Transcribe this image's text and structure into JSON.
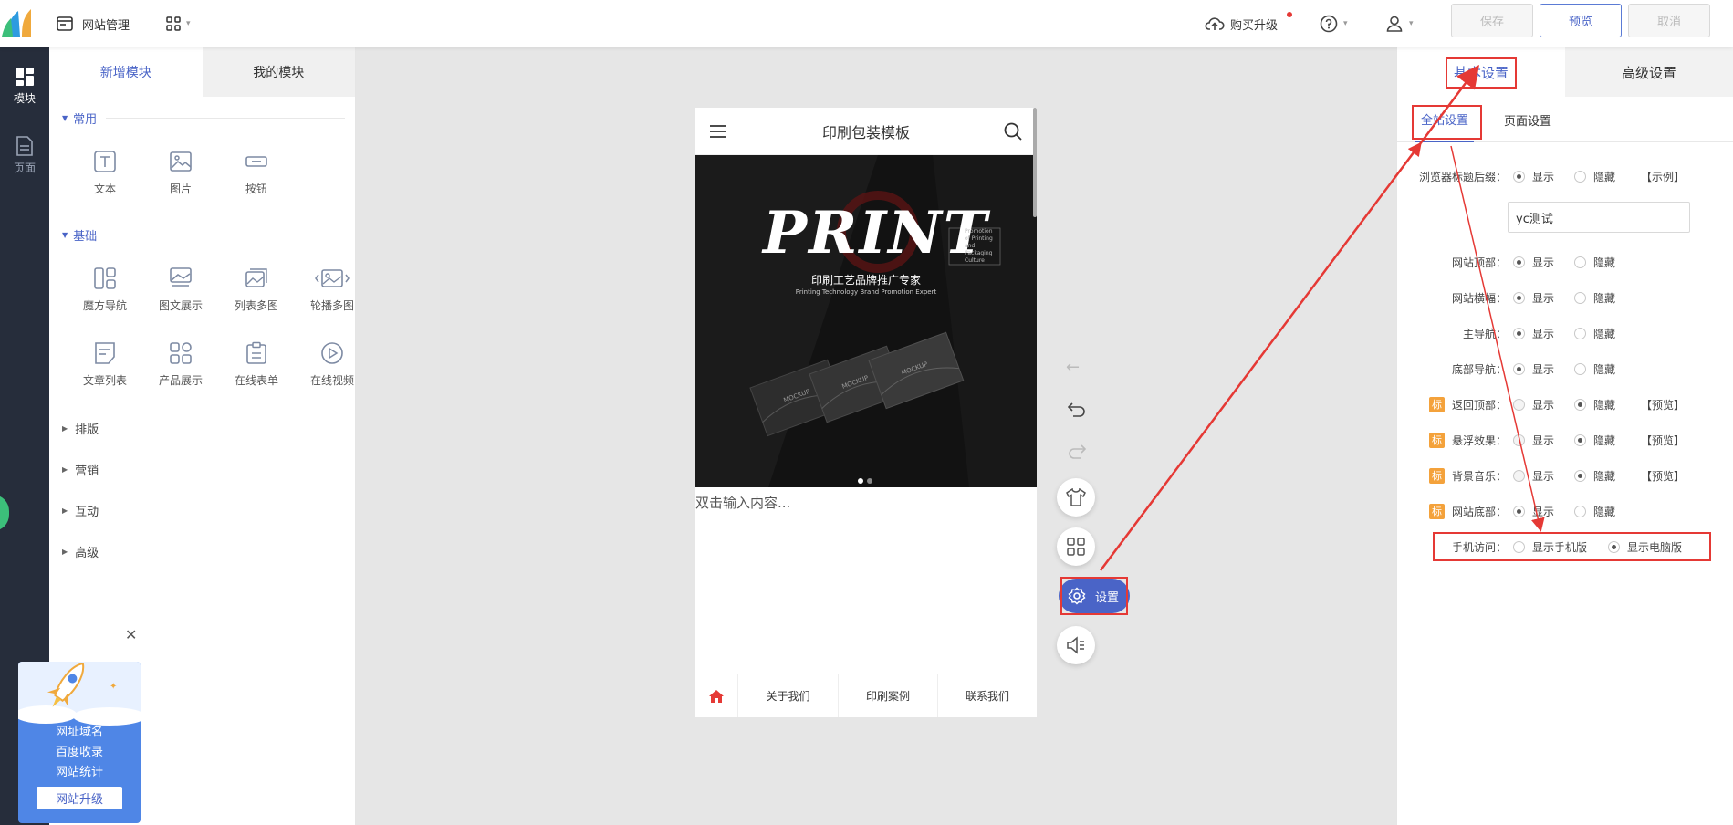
{
  "topbar": {
    "site_manage": "网站管理",
    "upgrade": "购买升级",
    "save": "保存",
    "preview": "预览",
    "cancel": "取消"
  },
  "leftnav": {
    "items": [
      {
        "label": "模块",
        "icon": "modules-icon"
      },
      {
        "label": "页面",
        "icon": "page-icon"
      }
    ]
  },
  "panel": {
    "tabs": [
      "新增模块",
      "我的模块"
    ],
    "sections": {
      "common": "常用",
      "basic": "基础"
    },
    "common_items": [
      "文本",
      "图片",
      "按钮"
    ],
    "basic_items": [
      "魔方导航",
      "图文展示",
      "列表多图",
      "轮播多图",
      "文章列表",
      "产品展示",
      "在线表单",
      "在线视频"
    ],
    "collapsed": [
      "排版",
      "营销",
      "互动",
      "高级"
    ]
  },
  "promo": {
    "lines": [
      "网址域名",
      "百度收录",
      "网站统计"
    ],
    "button": "网站升级"
  },
  "phone": {
    "title": "印刷包装模板",
    "banner_title": "PRINT",
    "banner_sub": "印刷工艺品牌推广专家",
    "banner_en": "Printing Technology Brand Promotion Expert",
    "banner_small": "Promotion of Printing and Packaging Culture",
    "card_text": "MOCKUP",
    "content_placeholder": "双击输入内容...",
    "footer": [
      "关于我们",
      "印刷案例",
      "联系我们"
    ]
  },
  "tools": {
    "settings_label": "设置"
  },
  "rpanel": {
    "tabs": [
      "基本设置",
      "高级设置"
    ],
    "subtabs": [
      "全站设置",
      "页面设置"
    ],
    "rows": [
      {
        "label": "浏览器标题后缀：",
        "badge": "",
        "opt1": "显示",
        "opt2": "隐藏",
        "note": "【示例】",
        "selected": 1
      },
      {
        "label": "网站顶部：",
        "badge": "",
        "opt1": "显示",
        "opt2": "隐藏",
        "note": "",
        "selected": 1
      },
      {
        "label": "网站横幅：",
        "badge": "",
        "opt1": "显示",
        "opt2": "隐藏",
        "note": "",
        "selected": 1
      },
      {
        "label": "主导航：",
        "badge": "",
        "opt1": "显示",
        "opt2": "隐藏",
        "note": "",
        "selected": 1
      },
      {
        "label": "底部导航：",
        "badge": "",
        "opt1": "显示",
        "opt2": "隐藏",
        "note": "",
        "selected": 1
      },
      {
        "label": "返回顶部：",
        "badge": "标",
        "opt1": "显示",
        "opt2": "隐藏",
        "note": "【预览】",
        "selected": 2
      },
      {
        "label": "悬浮效果：",
        "badge": "标",
        "opt1": "显示",
        "opt2": "隐藏",
        "note": "【预览】",
        "selected": 2
      },
      {
        "label": "背景音乐：",
        "badge": "标",
        "opt1": "显示",
        "opt2": "隐藏",
        "note": "【预览】",
        "selected": 2
      },
      {
        "label": "网站底部：",
        "badge": "标",
        "opt1": "显示",
        "opt2": "隐藏",
        "note": "",
        "selected": 1
      },
      {
        "label": "手机访问：",
        "badge": "",
        "opt1": "显示手机版",
        "opt2": "显示电脑版",
        "note": "",
        "selected": 2
      }
    ],
    "title_suffix_value": "yc测试"
  },
  "colors": {
    "accent": "#4a64c7",
    "annotation_red": "#e53935",
    "badge_orange": "#f4a23b"
  }
}
